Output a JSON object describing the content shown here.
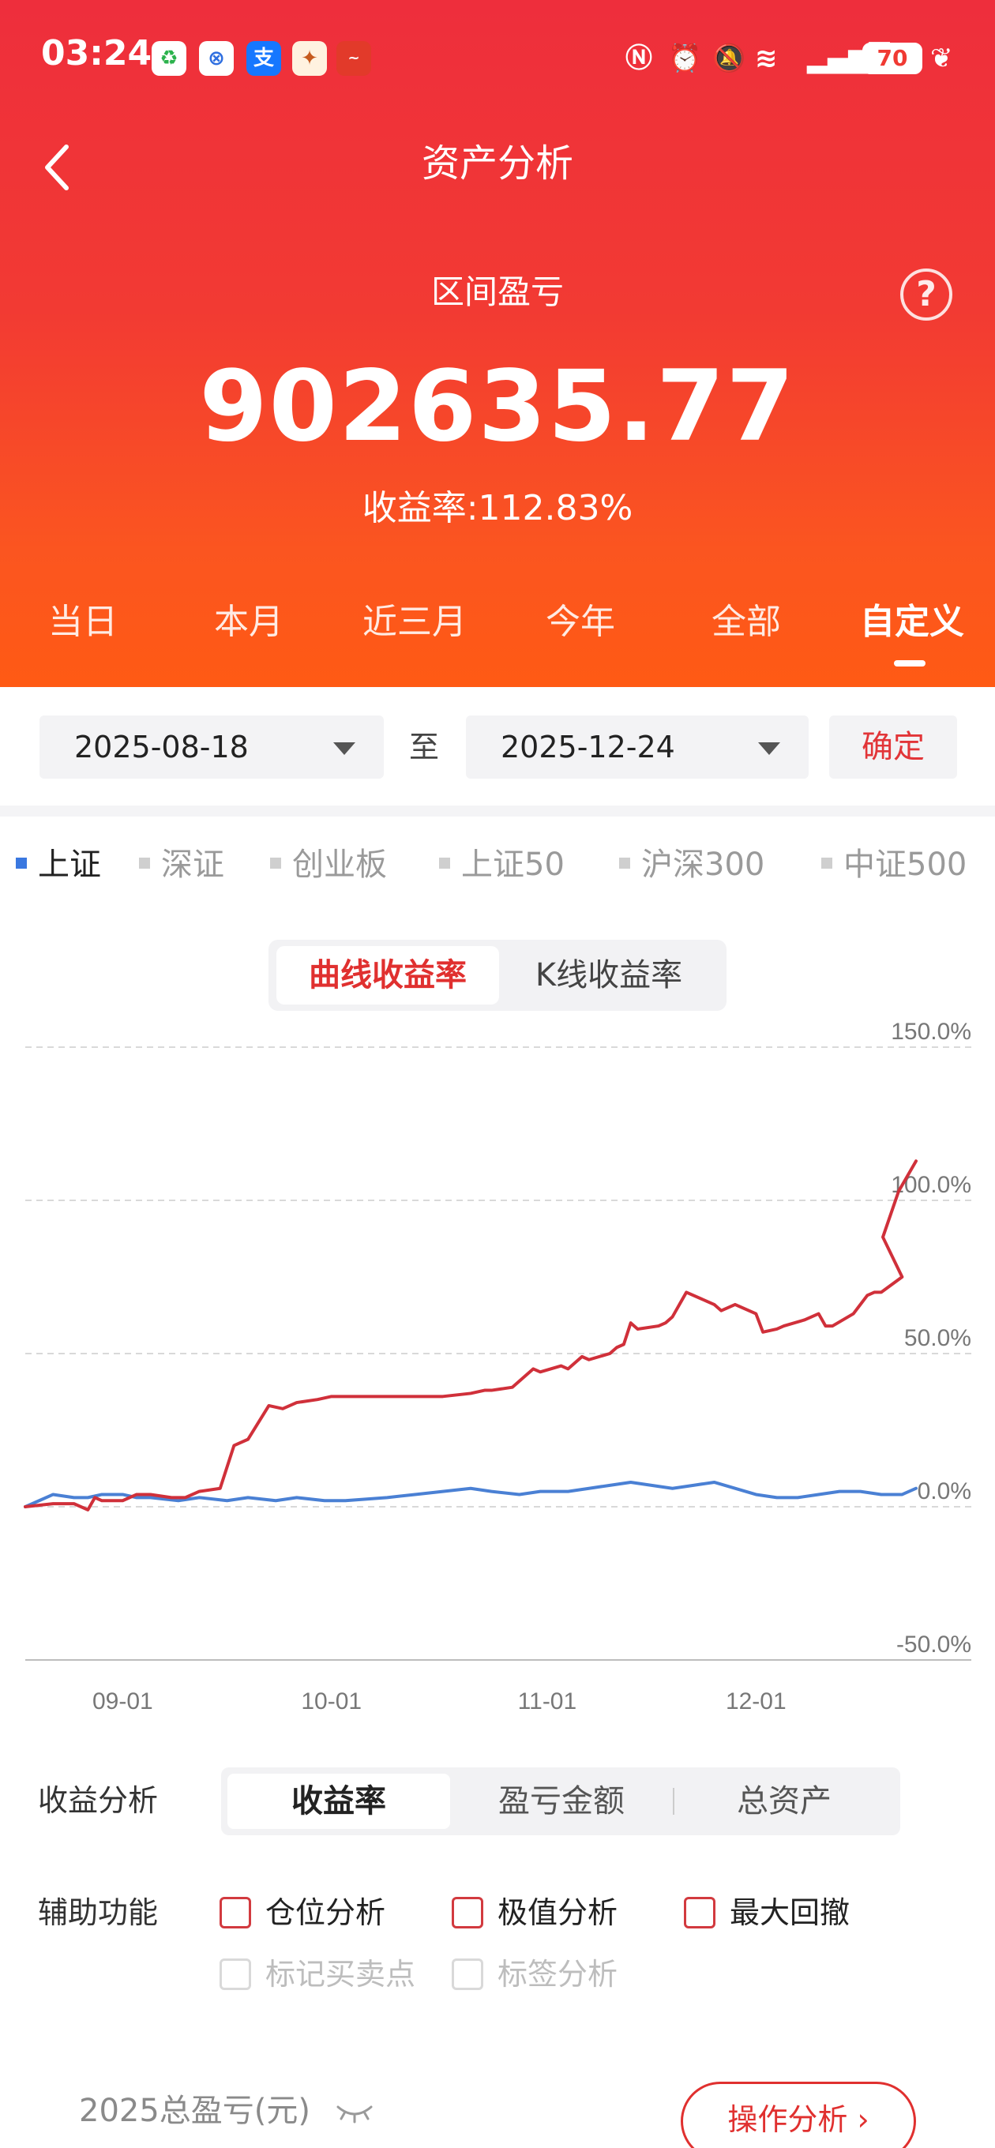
{
  "status_bar": {
    "time": "03:24",
    "battery": "70"
  },
  "header": {
    "title": "资产分析",
    "back_icon": "chevron-left-icon",
    "help_icon": "question-circle-icon"
  },
  "summary": {
    "label": "区间盈亏",
    "amount": "902635.77",
    "yield_text": "收益率:112.83%"
  },
  "period_tabs": [
    "当日",
    "本月",
    "近三月",
    "今年",
    "全部",
    "自定义"
  ],
  "period_tab_active": "自定义",
  "date_range": {
    "start": "2025-08-18",
    "to": "至",
    "end": "2025-12-24",
    "confirm": "确定"
  },
  "index_tabs": [
    "上证",
    "深证",
    "创业板",
    "上证50",
    "沪深300",
    "中证500"
  ],
  "index_tab_active": "上证",
  "chart_mode": {
    "options": [
      "曲线收益率",
      "K线收益率"
    ],
    "active": "曲线收益率"
  },
  "colors": {
    "accent": "#e0302f",
    "series_portfolio": "#d0303a",
    "series_index": "#4a80d4",
    "header_top": "#ee2e3c",
    "header_bottom": "#ff5a14"
  },
  "chart_data": {
    "type": "line",
    "y_tick_labels": [
      "150.0%",
      "100.0%",
      "50.0%",
      "0.0%",
      "-50.0%"
    ],
    "ylim": [
      -50,
      150
    ],
    "x_tick_labels": [
      "09-01",
      "10-01",
      "11-01",
      "12-01"
    ],
    "x_tick_dates": [
      "2025-09-01",
      "2025-10-01",
      "2025-11-01",
      "2025-12-01"
    ],
    "x_range": [
      "2025-08-18",
      "2025-12-24"
    ],
    "grid": true,
    "series": [
      {
        "color": "#d0303a",
        "points": [
          [
            "2025-08-18",
            0
          ],
          [
            "2025-08-22",
            1
          ],
          [
            "2025-08-25",
            1
          ],
          [
            "2025-08-27",
            -1
          ],
          [
            "2025-08-28",
            3
          ],
          [
            "2025-08-29",
            2
          ],
          [
            "2025-09-01",
            2
          ],
          [
            "2025-09-03",
            4
          ],
          [
            "2025-09-05",
            4
          ],
          [
            "2025-09-08",
            3
          ],
          [
            "2025-09-10",
            3
          ],
          [
            "2025-09-12",
            5
          ],
          [
            "2025-09-15",
            6
          ],
          [
            "2025-09-17",
            20
          ],
          [
            "2025-09-19",
            22
          ],
          [
            "2025-09-22",
            33
          ],
          [
            "2025-09-24",
            32
          ],
          [
            "2025-09-26",
            34
          ],
          [
            "2025-09-29",
            35
          ],
          [
            "2025-10-01",
            36
          ],
          [
            "2025-10-09",
            36
          ],
          [
            "2025-10-13",
            36
          ],
          [
            "2025-10-17",
            36
          ],
          [
            "2025-10-21",
            37
          ],
          [
            "2025-10-23",
            38
          ],
          [
            "2025-10-24",
            38
          ],
          [
            "2025-10-27",
            39
          ],
          [
            "2025-10-29",
            43
          ],
          [
            "2025-10-30",
            45
          ],
          [
            "2025-10-31",
            44
          ],
          [
            "2025-11-03",
            46
          ],
          [
            "2025-11-04",
            45
          ],
          [
            "2025-11-05",
            47
          ],
          [
            "2025-11-06",
            49
          ],
          [
            "2025-11-07",
            48
          ],
          [
            "2025-11-10",
            50
          ],
          [
            "2025-11-11",
            52
          ],
          [
            "2025-11-12",
            53
          ],
          [
            "2025-11-13",
            60
          ],
          [
            "2025-11-14",
            58
          ],
          [
            "2025-11-17",
            59
          ],
          [
            "2025-11-18",
            60
          ],
          [
            "2025-11-19",
            62
          ],
          [
            "2025-11-20",
            66
          ],
          [
            "2025-11-21",
            70
          ],
          [
            "2025-11-24",
            67
          ],
          [
            "2025-11-25",
            66
          ],
          [
            "2025-11-26",
            64
          ],
          [
            "2025-11-27",
            65
          ],
          [
            "2025-11-28",
            66
          ],
          [
            "2025-12-01",
            63
          ],
          [
            "2025-12-02",
            57
          ],
          [
            "2025-12-04",
            58
          ],
          [
            "2025-12-05",
            59
          ],
          [
            "2025-12-08",
            61
          ],
          [
            "2025-12-09",
            62
          ],
          [
            "2025-12-10",
            63
          ],
          [
            "2025-12-11",
            59
          ],
          [
            "2025-12-12",
            59
          ],
          [
            "2025-12-15",
            63
          ],
          [
            "2025-12-16",
            66
          ],
          [
            "2025-12-17",
            69
          ],
          [
            "2025-12-18",
            70
          ],
          [
            "2025-12-19",
            70
          ],
          [
            "2025-12-22",
            75
          ],
          [
            "2025-12-23",
            88
          ],
          [
            "2025-12-24",
            103
          ],
          [
            "2025-12-24",
            112.83
          ]
        ]
      },
      {
        "color": "#4a80d4",
        "points": [
          [
            "2025-08-18",
            0
          ],
          [
            "2025-08-20",
            2
          ],
          [
            "2025-08-22",
            4
          ],
          [
            "2025-08-25",
            3
          ],
          [
            "2025-08-27",
            3
          ],
          [
            "2025-08-29",
            4
          ],
          [
            "2025-09-01",
            4
          ],
          [
            "2025-09-03",
            3
          ],
          [
            "2025-09-05",
            3
          ],
          [
            "2025-09-09",
            2
          ],
          [
            "2025-09-12",
            3
          ],
          [
            "2025-09-16",
            2
          ],
          [
            "2025-09-19",
            3
          ],
          [
            "2025-09-23",
            2
          ],
          [
            "2025-09-26",
            3
          ],
          [
            "2025-09-30",
            2
          ],
          [
            "2025-10-03",
            2
          ],
          [
            "2025-10-09",
            3
          ],
          [
            "2025-10-13",
            4
          ],
          [
            "2025-10-17",
            5
          ],
          [
            "2025-10-21",
            6
          ],
          [
            "2025-10-24",
            5
          ],
          [
            "2025-10-28",
            4
          ],
          [
            "2025-10-31",
            5
          ],
          [
            "2025-11-04",
            5
          ],
          [
            "2025-11-07",
            6
          ],
          [
            "2025-11-10",
            7
          ],
          [
            "2025-11-13",
            8
          ],
          [
            "2025-11-16",
            7
          ],
          [
            "2025-11-19",
            6
          ],
          [
            "2025-11-22",
            7
          ],
          [
            "2025-11-25",
            8
          ],
          [
            "2025-11-28",
            6
          ],
          [
            "2025-12-01",
            4
          ],
          [
            "2025-12-04",
            3
          ],
          [
            "2025-12-07",
            3
          ],
          [
            "2025-12-10",
            4
          ],
          [
            "2025-12-13",
            5
          ],
          [
            "2025-12-16",
            5
          ],
          [
            "2025-12-19",
            4
          ],
          [
            "2025-12-22",
            4
          ],
          [
            "2025-12-24",
            6
          ]
        ]
      }
    ]
  },
  "analysis": {
    "label": "收益分析",
    "options": [
      "收益率",
      "盈亏金额",
      "总资产"
    ],
    "active": "收益率"
  },
  "aux": {
    "label": "辅助功能",
    "checkboxes": [
      {
        "label": "仓位分析",
        "enabled": true
      },
      {
        "label": "极值分析",
        "enabled": true
      },
      {
        "label": "最大回撤",
        "enabled": true
      },
      {
        "label": "标记买卖点",
        "enabled": false
      },
      {
        "label": "标签分析",
        "enabled": false
      }
    ]
  },
  "footer": {
    "total_label": "2025总盈亏(元)",
    "ops_button": "操作分析 ›"
  }
}
